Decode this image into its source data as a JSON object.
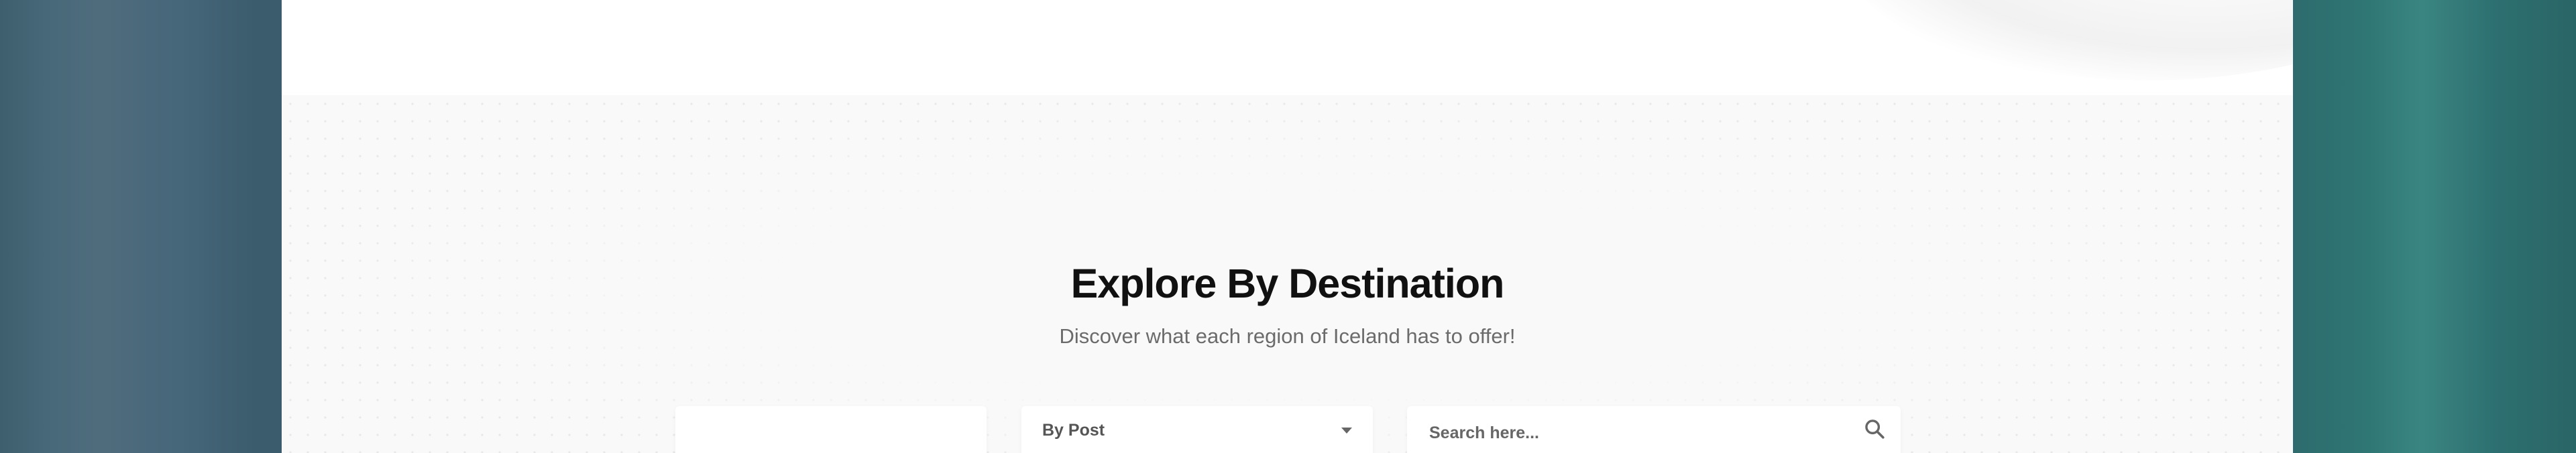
{
  "section": {
    "title": "Explore By Destination",
    "subtitle": "Discover what each region of Iceland has to offer!"
  },
  "filters": {
    "sort_select": {
      "selected": "By Post",
      "icon": "chevron-down-icon"
    },
    "search": {
      "placeholder": "Search here...",
      "value": "",
      "icon": "search-icon"
    }
  },
  "colors": {
    "panel_background": "#f9f9f9",
    "title_text": "#111111",
    "subtitle_text": "#6b6b6b",
    "left_backdrop": "#3e5f6d",
    "right_backdrop": "#2f7774"
  }
}
